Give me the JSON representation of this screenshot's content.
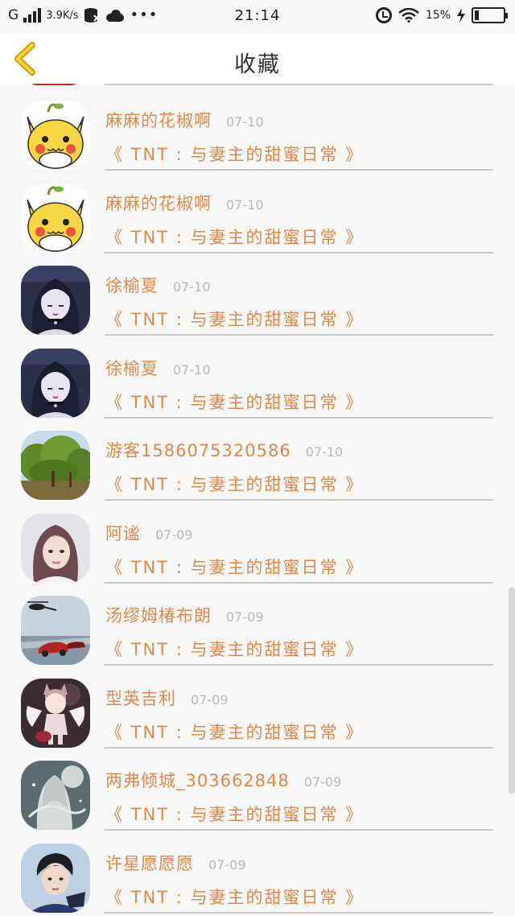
{
  "status_bar": {
    "network": "G",
    "speed": "3.9K/s",
    "time": "21:14",
    "battery": "15%",
    "battery_level": 0.15
  },
  "header": {
    "title": "收藏"
  },
  "items": [
    {
      "name": "麻麻的花椒啊",
      "date": "07-10",
      "book": "《 TNT : 与妻主的甜蜜日常 》",
      "avatar": "pikachu-avatar"
    },
    {
      "name": "麻麻的花椒啊",
      "date": "07-10",
      "book": "《 TNT : 与妻主的甜蜜日常 》",
      "avatar": "pikachu-avatar"
    },
    {
      "name": "徐榆夏",
      "date": "07-10",
      "book": "《 TNT : 与妻主的甜蜜日常 》",
      "avatar": "anime-girl-avatar"
    },
    {
      "name": "徐榆夏",
      "date": "07-10",
      "book": "《 TNT : 与妻主的甜蜜日常 》",
      "avatar": "anime-girl-avatar"
    },
    {
      "name": "游客15860753205​86",
      "date": "07-10",
      "book": "《 TNT : 与妻主的甜蜜日常 》",
      "avatar": "tree-avatar"
    },
    {
      "name": "阿谧",
      "date": "07-09",
      "book": "《 TNT : 与妻主的甜蜜日常 》",
      "avatar": "girl-photo-avatar"
    },
    {
      "name": "汤缪姆椿布朗",
      "date": "07-09",
      "book": "《 TNT : 与妻主的甜蜜日常 》",
      "avatar": "car-helicopter-avatar"
    },
    {
      "name": "型英吉利",
      "date": "07-09",
      "book": "《 TNT : 与妻主的甜蜜日常 》",
      "avatar": "catgirl-avatar"
    },
    {
      "name": "两弗倾城_303662848",
      "date": "07-09",
      "book": "《 TNT : 与妻主的甜蜜日常 》",
      "avatar": "fairy-avatar"
    },
    {
      "name": "许星愿愿愿",
      "date": "07-09",
      "book": "《 TNT : 与妻主的甜蜜日常 》",
      "avatar": "boy-photo-avatar"
    }
  ]
}
